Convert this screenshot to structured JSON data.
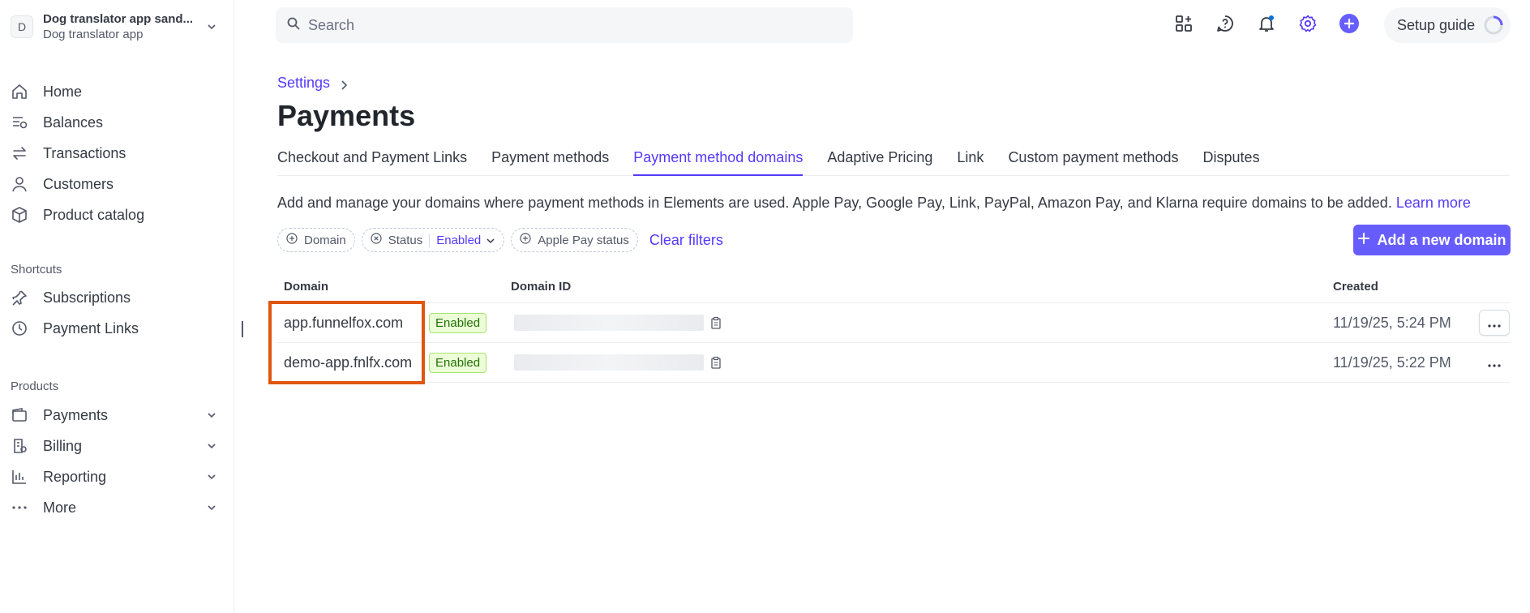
{
  "account": {
    "avatar_letter": "D",
    "name": "Dog translator app sand...",
    "subtitle": "Dog translator app"
  },
  "nav": {
    "home": "Home",
    "balances": "Balances",
    "transactions": "Transactions",
    "customers": "Customers",
    "product_catalog": "Product catalog"
  },
  "shortcuts": {
    "label": "Shortcuts",
    "subscriptions": "Subscriptions",
    "payment_links": "Payment Links"
  },
  "products": {
    "label": "Products",
    "payments": "Payments",
    "billing": "Billing",
    "reporting": "Reporting",
    "more": "More"
  },
  "search": {
    "placeholder": "Search"
  },
  "topbar": {
    "setup_guide": "Setup guide"
  },
  "breadcrumb": {
    "settings": "Settings"
  },
  "page": {
    "title": "Payments"
  },
  "tabs": [
    {
      "label": "Checkout and Payment Links"
    },
    {
      "label": "Payment methods"
    },
    {
      "label": "Payment method domains"
    },
    {
      "label": "Adaptive Pricing"
    },
    {
      "label": "Link"
    },
    {
      "label": "Custom payment methods"
    },
    {
      "label": "Disputes"
    }
  ],
  "description": {
    "text": "Add and manage your domains where payment methods in Elements are used. Apple Pay, Google Pay, Link, PayPal, Amazon Pay, and Klarna require domains to be added.",
    "link": "Learn more"
  },
  "filters": {
    "domain": "Domain",
    "status": "Status",
    "status_value": "Enabled",
    "apple_pay_status": "Apple Pay status",
    "clear": "Clear filters"
  },
  "add_button": "Add a new domain",
  "table": {
    "headers": {
      "domain": "Domain",
      "domain_id": "Domain ID",
      "created": "Created"
    },
    "rows": [
      {
        "domain": "app.funnelfox.com",
        "status": "Enabled",
        "created": "11/19/25, 5:24 PM"
      },
      {
        "domain": "demo-app.fnlfx.com",
        "status": "Enabled",
        "created": "11/19/25, 5:22 PM"
      }
    ]
  },
  "colors": {
    "accent": "#533afd",
    "button": "#675dff",
    "highlight": "#e0560d",
    "badge_text": "#217005",
    "badge_bg": "#ecfed7"
  }
}
